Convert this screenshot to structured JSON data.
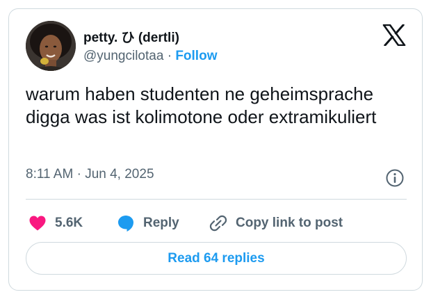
{
  "author": {
    "display_name": "petty. ひ (dertli)",
    "handle": "@yungcilotaa",
    "separator": "·",
    "follow_label": "Follow"
  },
  "tweet": {
    "text": "warum haben studenten ne geheimsprache digga was ist kolimotone oder extramikuliert",
    "time": "8:11 AM",
    "date_separator": "·",
    "date": "Jun 4, 2025"
  },
  "actions": {
    "like_count": "5.6K",
    "reply_label": "Reply",
    "copy_link_label": "Copy link to post",
    "read_replies_label": "Read 64 replies"
  },
  "icons": {
    "brand": "x-logo-icon",
    "info": "info-icon",
    "like": "heart-icon",
    "reply": "speech-bubble-icon",
    "copy": "link-icon"
  },
  "colors": {
    "accent": "#1d9bf0",
    "like": "#f91880",
    "text_primary": "#0f1419",
    "text_secondary": "#536471",
    "border": "#cfd9de"
  }
}
